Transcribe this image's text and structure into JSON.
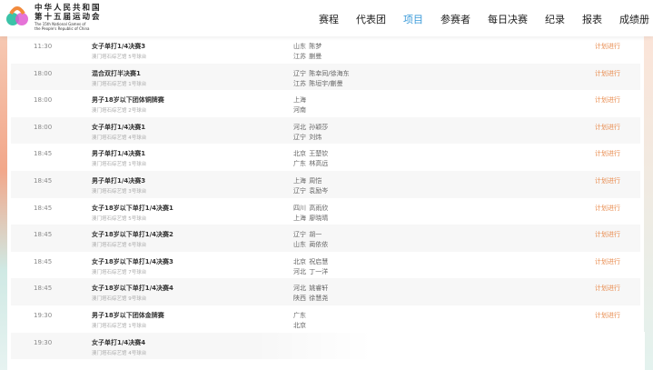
{
  "header": {
    "logo_cn_line1": "中华人民共和国",
    "logo_cn_line2": "第十五届运动会",
    "logo_en_line1": "The 15th National Games of",
    "logo_en_line2": "the People's Republic of China",
    "nav": [
      {
        "label": "赛程",
        "active": false
      },
      {
        "label": "代表团",
        "active": false
      },
      {
        "label": "项目",
        "active": true
      },
      {
        "label": "参赛者",
        "active": false
      },
      {
        "label": "每日决赛",
        "active": false
      },
      {
        "label": "纪录",
        "active": false
      },
      {
        "label": "报表",
        "active": false
      },
      {
        "label": "成绩册",
        "active": false
      }
    ]
  },
  "rows": [
    {
      "time": "11:30",
      "event": "女子单打1/4决赛3",
      "venue": "澳门塔石综艺馆 5号球台",
      "teams": [
        {
          "prov": "山东",
          "name": "陈梦"
        },
        {
          "prov": "江苏",
          "name": "蒯曼"
        }
      ],
      "status": "计划进行"
    },
    {
      "time": "18:00",
      "event": "混合双打半决赛1",
      "venue": "澳门塔石综艺馆 1号球台",
      "teams": [
        {
          "prov": "辽宁",
          "name": "陈幸同/徐海东"
        },
        {
          "prov": "江苏",
          "name": "陈垣宇/蒯曼"
        }
      ],
      "status": "计划进行"
    },
    {
      "time": "18:00",
      "event": "男子18岁以下团体铜牌赛",
      "venue": "澳门塔石综艺馆 2号球台",
      "teams": [
        {
          "prov": "上海",
          "name": ""
        },
        {
          "prov": "河南",
          "name": ""
        }
      ],
      "status": "计划进行"
    },
    {
      "time": "18:00",
      "event": "女子单打1/4决赛1",
      "venue": "澳门塔石综艺馆 4号球台",
      "teams": [
        {
          "prov": "河北",
          "name": "孙颖莎"
        },
        {
          "prov": "辽宁",
          "name": "刘炜"
        }
      ],
      "status": "计划进行"
    },
    {
      "time": "18:45",
      "event": "男子单打1/4决赛1",
      "venue": "澳门塔石综艺馆 1号球台",
      "teams": [
        {
          "prov": "北京",
          "name": "王楚钦"
        },
        {
          "prov": "广东",
          "name": "林高远"
        }
      ],
      "status": "计划进行"
    },
    {
      "time": "18:45",
      "event": "男子单打1/4决赛3",
      "venue": "澳门塔石综艺馆 3号球台",
      "teams": [
        {
          "prov": "上海",
          "name": "周恺"
        },
        {
          "prov": "辽宁",
          "name": "袁励岑"
        }
      ],
      "status": "计划进行"
    },
    {
      "time": "18:45",
      "event": "女子18岁以下单打1/4决赛1",
      "venue": "澳门塔石综艺馆 5号球台",
      "teams": [
        {
          "prov": "四川",
          "name": "高雨欣"
        },
        {
          "prov": "上海",
          "name": "廖晓晴"
        }
      ],
      "status": "计划进行"
    },
    {
      "time": "18:45",
      "event": "女子18岁以下单打1/4决赛2",
      "venue": "澳门塔石综艺馆 6号球台",
      "teams": [
        {
          "prov": "辽宁",
          "name": "胡一"
        },
        {
          "prov": "山东",
          "name": "蔺依依"
        }
      ],
      "status": "计划进行"
    },
    {
      "time": "18:45",
      "event": "女子18岁以下单打1/4决赛3",
      "venue": "澳门塔石综艺馆 7号球台",
      "teams": [
        {
          "prov": "北京",
          "name": "祝启慧"
        },
        {
          "prov": "河北",
          "name": "丁一洋"
        }
      ],
      "status": "计划进行"
    },
    {
      "time": "18:45",
      "event": "女子18岁以下单打1/4决赛4",
      "venue": "澳门塔石综艺馆 9号球台",
      "teams": [
        {
          "prov": "河北",
          "name": "姚睿轩"
        },
        {
          "prov": "陕西",
          "name": "徐慧尧"
        }
      ],
      "status": "计划进行"
    },
    {
      "time": "19:30",
      "event": "男子18岁以下团体金牌赛",
      "venue": "澳门塔石综艺馆 1号球台",
      "teams": [
        {
          "prov": "广东",
          "name": ""
        },
        {
          "prov": "北京",
          "name": ""
        }
      ],
      "status": "计划进行"
    },
    {
      "time": "19:30",
      "event": "女子单打1/4决赛4",
      "venue": "澳门塔石综艺馆 4号球台",
      "teams": [],
      "status": ""
    }
  ]
}
